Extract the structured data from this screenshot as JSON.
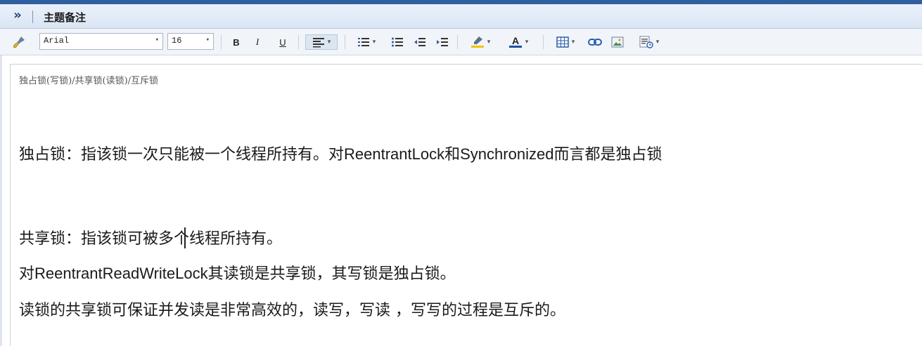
{
  "titlebar": {
    "collapse_glyph": "»",
    "title": "主题备注"
  },
  "toolbar": {
    "font_family": "Arial",
    "font_size": "16",
    "bold": "B",
    "italic": "I",
    "underline": "U",
    "dropdown_caret": "▾",
    "icons": [
      "clear-format-icon",
      "align-left-icon",
      "numbered-list-icon",
      "bullet-list-icon",
      "decrease-indent-icon",
      "increase-indent-icon",
      "highlight-color-icon",
      "font-color-icon",
      "table-icon",
      "link-icon",
      "image-icon",
      "insert-template-icon"
    ],
    "colors": {
      "highlight": "#f2c200",
      "font_color": "#1f4ea8"
    }
  },
  "subject": {
    "text": "独占锁(写锁)/共享锁(读锁)/互斥锁"
  },
  "editor": {
    "line1_a": "独占锁：指该锁一次只能被一个线程所持有。对",
    "line1_b": "ReentrantLock",
    "line1_c": "和",
    "line1_d": "Synchronized",
    "line1_e": "而言都是独占锁",
    "line2": "共享锁：指该锁可被多个线程所持有。",
    "line3_a": "对",
    "line3_b": "ReentrantReadWriteLock",
    "line3_c": "其读锁是共享锁，其写锁是独占锁。",
    "line4": "读锁的共享锁可保证并发读是非常高效的，读写，写读 ，写写的过程是互斥的。"
  }
}
